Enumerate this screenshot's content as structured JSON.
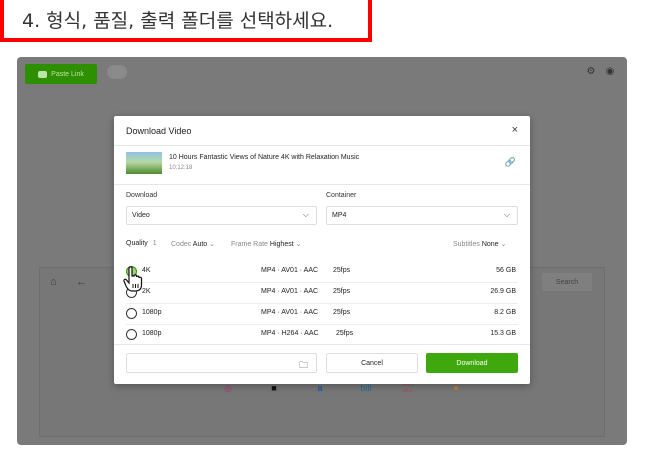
{
  "caption": {
    "text": "4. 형식, 품질, 출력 폴더를 선택하세요."
  },
  "app": {
    "paste_link_label": "Paste Link",
    "search_label": "Search",
    "sites": [
      "instagram",
      "tiktok",
      "dailymotion",
      "bilibili",
      "adult sites",
      "likee"
    ],
    "adult_label": "adult\nsites"
  },
  "dialog": {
    "title": "Download Video",
    "close_glyph": "×",
    "video": {
      "title": "10 Hours Fantastic Views of Nature 4K with Relaxation Music",
      "duration": "10:12:18"
    },
    "download_label": "Download",
    "download_value": "Video",
    "container_label": "Container",
    "container_value": "MP4",
    "filters": {
      "quality_label": "Quality",
      "quality_count": "1",
      "codec_label": "Codec",
      "codec_value": "Auto",
      "framerate_label": "Frame Rate",
      "framerate_value": "Highest",
      "subtitles_label": "Subtitles",
      "subtitles_value": "None"
    },
    "rows": [
      {
        "res": "4K",
        "fmt": "MP4 · AV01 · AAC",
        "fps": "25fps",
        "size": "56 GB",
        "selected": true
      },
      {
        "res": "2K",
        "fmt": "MP4 · AV01 · AAC",
        "fps": "25fps",
        "size": "26.9 GB",
        "selected": false
      },
      {
        "res": "1080p",
        "fmt": "MP4 · AV01 · AAC",
        "fps": "25fps",
        "size": "8.2 GB",
        "selected": false
      },
      {
        "res": "1080p",
        "fmt": "MP4 · H264 · AAC",
        "fps": "25fps",
        "size": "15.3 GB",
        "selected": false
      }
    ],
    "cancel_label": "Cancel",
    "download_button_label": "Download"
  },
  "colors": {
    "accent": "#3fa80c",
    "highlight": "#ff0000"
  }
}
